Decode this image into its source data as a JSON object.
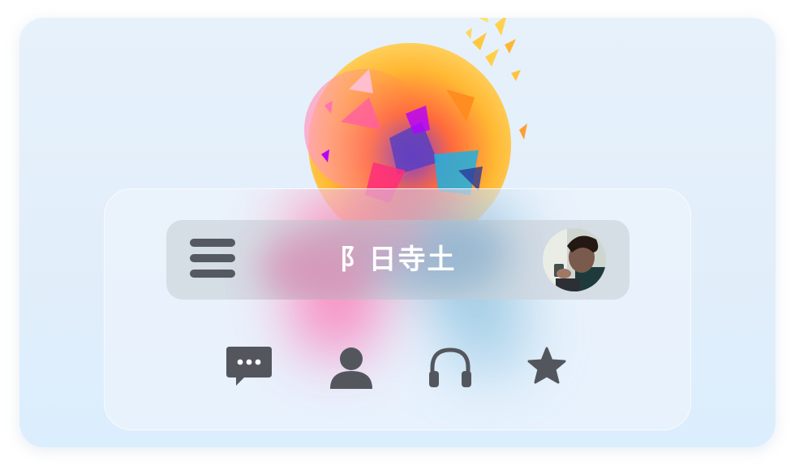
{
  "app": {
    "brand_text": "阝日寺土"
  },
  "nav": {
    "menu_icon": "hamburger-menu-icon",
    "avatar_icon": "user-avatar-photo"
  },
  "dock": {
    "items": [
      {
        "icon": "chat-bubble-icon"
      },
      {
        "icon": "person-icon"
      },
      {
        "icon": "headphones-icon"
      },
      {
        "icon": "star-icon"
      }
    ]
  },
  "colors": {
    "background": "#e4f0fa",
    "icon": "#53575d",
    "brand_text": "#ffffff"
  }
}
